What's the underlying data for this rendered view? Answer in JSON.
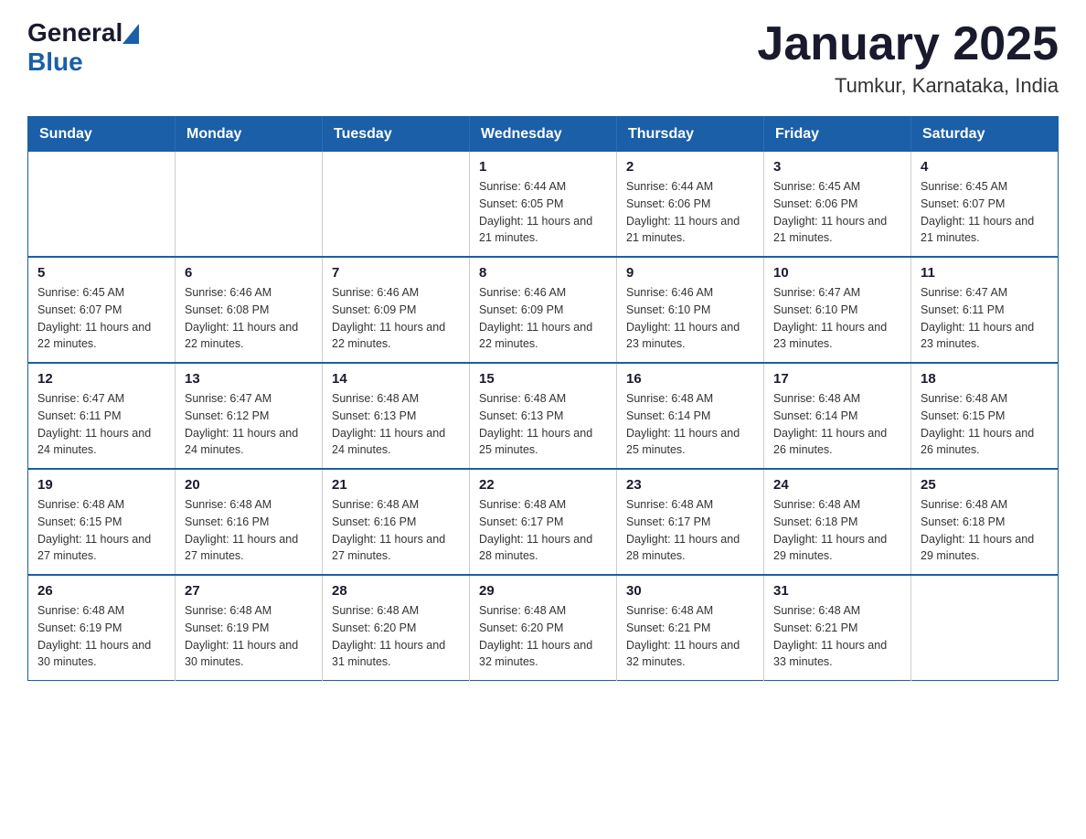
{
  "header": {
    "logo": {
      "general": "General",
      "blue": "Blue"
    },
    "title": "January 2025",
    "subtitle": "Tumkur, Karnataka, India"
  },
  "calendar": {
    "days_of_week": [
      "Sunday",
      "Monday",
      "Tuesday",
      "Wednesday",
      "Thursday",
      "Friday",
      "Saturday"
    ],
    "weeks": [
      [
        {
          "day": "",
          "info": ""
        },
        {
          "day": "",
          "info": ""
        },
        {
          "day": "",
          "info": ""
        },
        {
          "day": "1",
          "sunrise": "6:44 AM",
          "sunset": "6:05 PM",
          "daylight": "11 hours and 21 minutes."
        },
        {
          "day": "2",
          "sunrise": "6:44 AM",
          "sunset": "6:06 PM",
          "daylight": "11 hours and 21 minutes."
        },
        {
          "day": "3",
          "sunrise": "6:45 AM",
          "sunset": "6:06 PM",
          "daylight": "11 hours and 21 minutes."
        },
        {
          "day": "4",
          "sunrise": "6:45 AM",
          "sunset": "6:07 PM",
          "daylight": "11 hours and 21 minutes."
        }
      ],
      [
        {
          "day": "5",
          "sunrise": "6:45 AM",
          "sunset": "6:07 PM",
          "daylight": "11 hours and 22 minutes."
        },
        {
          "day": "6",
          "sunrise": "6:46 AM",
          "sunset": "6:08 PM",
          "daylight": "11 hours and 22 minutes."
        },
        {
          "day": "7",
          "sunrise": "6:46 AM",
          "sunset": "6:09 PM",
          "daylight": "11 hours and 22 minutes."
        },
        {
          "day": "8",
          "sunrise": "6:46 AM",
          "sunset": "6:09 PM",
          "daylight": "11 hours and 22 minutes."
        },
        {
          "day": "9",
          "sunrise": "6:46 AM",
          "sunset": "6:10 PM",
          "daylight": "11 hours and 23 minutes."
        },
        {
          "day": "10",
          "sunrise": "6:47 AM",
          "sunset": "6:10 PM",
          "daylight": "11 hours and 23 minutes."
        },
        {
          "day": "11",
          "sunrise": "6:47 AM",
          "sunset": "6:11 PM",
          "daylight": "11 hours and 23 minutes."
        }
      ],
      [
        {
          "day": "12",
          "sunrise": "6:47 AM",
          "sunset": "6:11 PM",
          "daylight": "11 hours and 24 minutes."
        },
        {
          "day": "13",
          "sunrise": "6:47 AM",
          "sunset": "6:12 PM",
          "daylight": "11 hours and 24 minutes."
        },
        {
          "day": "14",
          "sunrise": "6:48 AM",
          "sunset": "6:13 PM",
          "daylight": "11 hours and 24 minutes."
        },
        {
          "day": "15",
          "sunrise": "6:48 AM",
          "sunset": "6:13 PM",
          "daylight": "11 hours and 25 minutes."
        },
        {
          "day": "16",
          "sunrise": "6:48 AM",
          "sunset": "6:14 PM",
          "daylight": "11 hours and 25 minutes."
        },
        {
          "day": "17",
          "sunrise": "6:48 AM",
          "sunset": "6:14 PM",
          "daylight": "11 hours and 26 minutes."
        },
        {
          "day": "18",
          "sunrise": "6:48 AM",
          "sunset": "6:15 PM",
          "daylight": "11 hours and 26 minutes."
        }
      ],
      [
        {
          "day": "19",
          "sunrise": "6:48 AM",
          "sunset": "6:15 PM",
          "daylight": "11 hours and 27 minutes."
        },
        {
          "day": "20",
          "sunrise": "6:48 AM",
          "sunset": "6:16 PM",
          "daylight": "11 hours and 27 minutes."
        },
        {
          "day": "21",
          "sunrise": "6:48 AM",
          "sunset": "6:16 PM",
          "daylight": "11 hours and 27 minutes."
        },
        {
          "day": "22",
          "sunrise": "6:48 AM",
          "sunset": "6:17 PM",
          "daylight": "11 hours and 28 minutes."
        },
        {
          "day": "23",
          "sunrise": "6:48 AM",
          "sunset": "6:17 PM",
          "daylight": "11 hours and 28 minutes."
        },
        {
          "day": "24",
          "sunrise": "6:48 AM",
          "sunset": "6:18 PM",
          "daylight": "11 hours and 29 minutes."
        },
        {
          "day": "25",
          "sunrise": "6:48 AM",
          "sunset": "6:18 PM",
          "daylight": "11 hours and 29 minutes."
        }
      ],
      [
        {
          "day": "26",
          "sunrise": "6:48 AM",
          "sunset": "6:19 PM",
          "daylight": "11 hours and 30 minutes."
        },
        {
          "day": "27",
          "sunrise": "6:48 AM",
          "sunset": "6:19 PM",
          "daylight": "11 hours and 30 minutes."
        },
        {
          "day": "28",
          "sunrise": "6:48 AM",
          "sunset": "6:20 PM",
          "daylight": "11 hours and 31 minutes."
        },
        {
          "day": "29",
          "sunrise": "6:48 AM",
          "sunset": "6:20 PM",
          "daylight": "11 hours and 32 minutes."
        },
        {
          "day": "30",
          "sunrise": "6:48 AM",
          "sunset": "6:21 PM",
          "daylight": "11 hours and 32 minutes."
        },
        {
          "day": "31",
          "sunrise": "6:48 AM",
          "sunset": "6:21 PM",
          "daylight": "11 hours and 33 minutes."
        },
        {
          "day": "",
          "info": ""
        }
      ]
    ]
  }
}
